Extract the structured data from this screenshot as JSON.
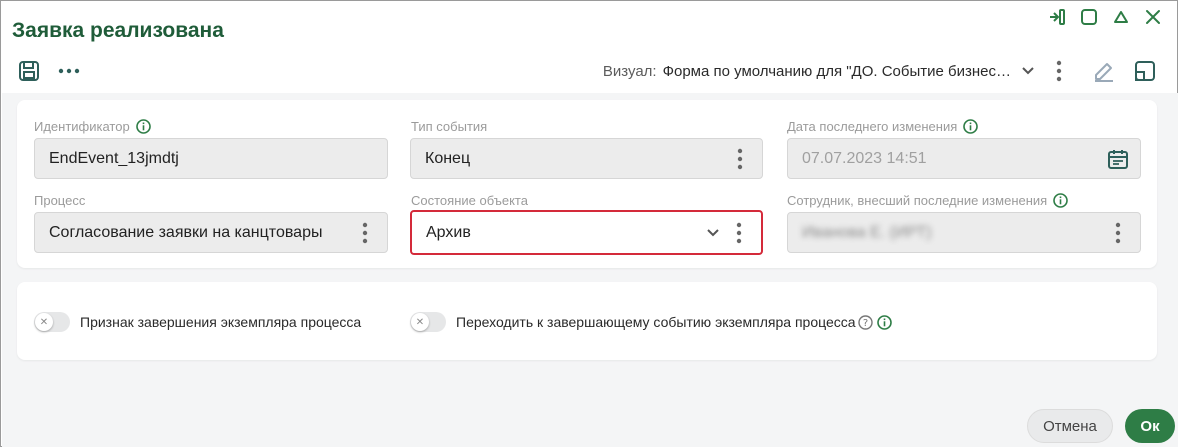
{
  "window": {
    "title": "Заявка реализована"
  },
  "visual": {
    "label": "Визуал:",
    "value": "Форма по умолчанию для \"ДО. Событие бизнес…"
  },
  "fields": {
    "identifier": {
      "label": "Идентификатор",
      "value": "EndEvent_13jmdtj"
    },
    "event_type": {
      "label": "Тип события",
      "value": "Конец"
    },
    "last_modified": {
      "label": "Дата последнего изменения",
      "value": "07.07.2023 14:51"
    },
    "process": {
      "label": "Процесс",
      "value": "Согласование заявки на канцтовары"
    },
    "object_state": {
      "label": "Состояние объекта",
      "value": "Архив"
    },
    "modified_by": {
      "label": "Сотрудник, внесший последние изменения",
      "value": "Иванова Е. (ИРТ)"
    }
  },
  "toggles": {
    "completion": {
      "label": "Признак завершения экземпляра процесса",
      "on": false
    },
    "goto_final": {
      "label": "Переходить к завершающему событию экземпляра процесса",
      "on": false
    }
  },
  "buttons": {
    "cancel": "Отмена",
    "ok": "Ок"
  },
  "colors": {
    "accent": "#2e7d46",
    "title": "#1f5c39",
    "highlight": "#d42a3a"
  },
  "icons": [
    "pin-icon",
    "maximize-icon",
    "collapse-icon",
    "close-icon",
    "save-icon",
    "more-icon",
    "chevron-down-icon",
    "kebab-icon",
    "edit-icon",
    "layout-icon",
    "info-icon",
    "calendar-icon",
    "help-icon"
  ]
}
